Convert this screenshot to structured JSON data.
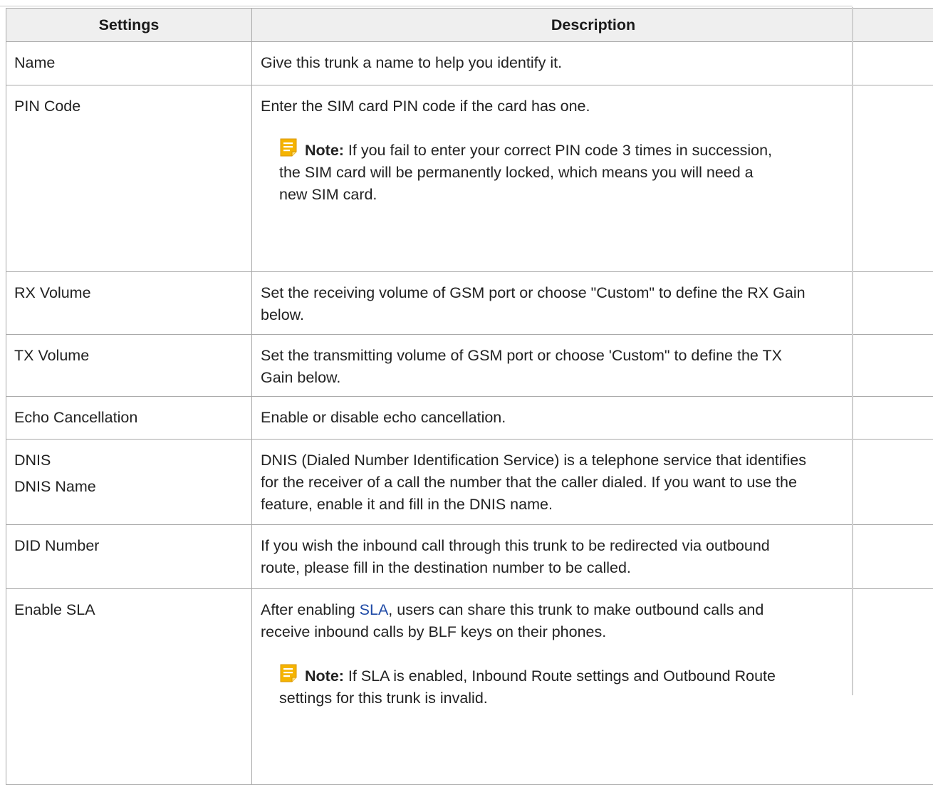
{
  "table": {
    "headers": {
      "settings": "Settings",
      "description": "Description"
    },
    "rows": [
      {
        "names": [
          "Name"
        ],
        "desc_parts": [
          "Give this trunk a name to help you identify it."
        ]
      },
      {
        "names": [
          "PIN Code"
        ],
        "desc_parts": [
          "Enter the SIM card PIN code if the card has one."
        ],
        "note": {
          "label": "Note:",
          "line1": "If you fail to enter your correct PIN code 3 times in succession,",
          "line2": "the SIM card will be permanently locked, which means you will need a",
          "line3": "new SIM card."
        }
      },
      {
        "names": [
          "RX Volume"
        ],
        "desc_parts": [
          "Set the receiving volume of GSM port or choose \"Custom\" to define the RX Gain",
          "below."
        ]
      },
      {
        "names": [
          "TX Volume"
        ],
        "desc_parts": [
          "Set the transmitting volume of GSM port or choose 'Custom\" to define the TX",
          "Gain below."
        ]
      },
      {
        "names": [
          "Echo Cancellation"
        ],
        "desc_parts": [
          "Enable or disable echo cancellation."
        ]
      },
      {
        "names": [
          "DNIS",
          "DNIS Name"
        ],
        "desc_parts": [
          "DNIS (Dialed Number Identification Service) is a telephone service that identifies",
          "for the receiver of a call the number that the caller dialed. If you want to use the",
          "feature, enable it and fill in the DNIS name."
        ]
      },
      {
        "names": [
          "DID Number"
        ],
        "desc_parts": [
          "If you wish the inbound call through this trunk to be redirected via outbound",
          "route, please fill in the destination number to be called."
        ]
      },
      {
        "names": [
          "Enable SLA"
        ],
        "desc_parts": [
          "After enabling ",
          "SLA",
          ", users can share this trunk to make outbound calls and",
          "receive inbound calls by BLF keys on their phones."
        ],
        "note": {
          "label": "Note:",
          "line1": "If SLA is enabled, Inbound Route settings and Outbound Route",
          "line2": "settings for this trunk is invalid."
        }
      }
    ]
  },
  "icons": {
    "note": "note-icon"
  },
  "colors": {
    "note_icon": "#f5b400",
    "link": "#1f4aa6",
    "header_bg": "#efefef",
    "border": "#a9a9a9"
  }
}
